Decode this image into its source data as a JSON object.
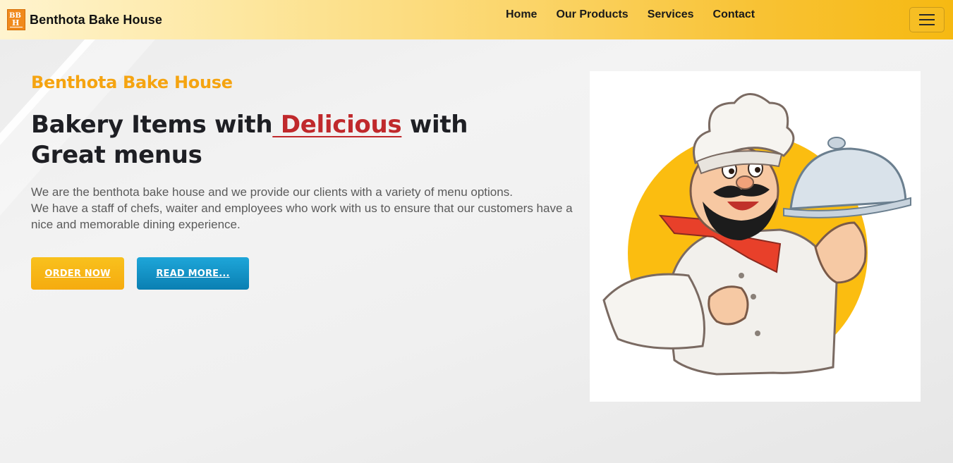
{
  "navbar": {
    "brand_logo_letters": "BBH",
    "brand_name": "Benthota Bake House",
    "links": [
      {
        "label": "Home"
      },
      {
        "label": "Our Products"
      },
      {
        "label": "Services"
      },
      {
        "label": "Contact"
      }
    ]
  },
  "hero": {
    "subtitle": "Benthota Bake House",
    "headline_before": "Bakery Items with",
    "headline_accent": " Delicious",
    "headline_after": " with Great menus",
    "description_line1": "We are the benthota bake house and we provide our clients with a variety of menu options.",
    "description_line2": "We have a staff of chefs, waiter and employees who work with us to ensure that our customers have a nice and memorable dining experience.",
    "order_button": "ORDER NOW",
    "read_button": "READ MORE...",
    "image_icon": "chef-mascot-illustration"
  },
  "colors": {
    "accent_orange": "#f5a411",
    "accent_red": "#c0292c",
    "button_orange": "#f6ab0f",
    "button_blue": "#0a7fb2",
    "navbar_gold": "#f6b912"
  }
}
